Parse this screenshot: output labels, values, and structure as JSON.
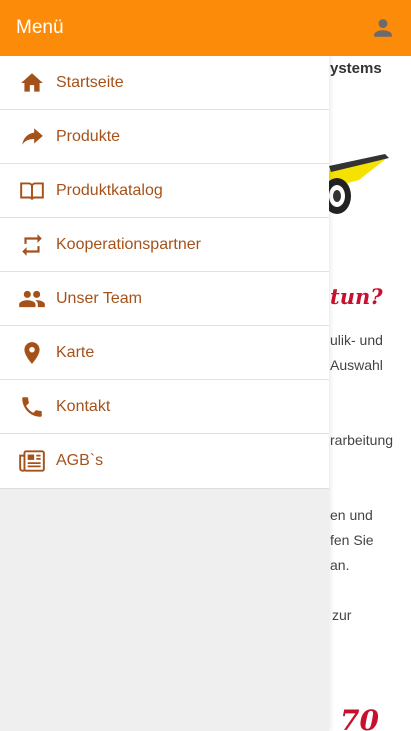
{
  "header": {
    "title": "Menü",
    "user_icon": "account-icon"
  },
  "menu": {
    "items": [
      {
        "label": "Startseite",
        "icon": "home-icon"
      },
      {
        "label": "Produkte",
        "icon": "share-arrow-icon"
      },
      {
        "label": "Produktkatalog",
        "icon": "book-icon"
      },
      {
        "label": "Kooperationspartner",
        "icon": "repeat-icon"
      },
      {
        "label": "Unser Team",
        "icon": "group-icon"
      },
      {
        "label": "Karte",
        "icon": "map-pin-icon"
      },
      {
        "label": "Kontakt",
        "icon": "phone-icon"
      },
      {
        "label": "AGB`s",
        "icon": "newspaper-icon"
      }
    ]
  },
  "background": {
    "brand_fragment": "ystems",
    "slogan_fragment": "tun?",
    "lines": [
      "ulik- und",
      "Auswahl",
      "rarbeitung",
      "en und",
      "fen Sie",
      "an.",
      "zur"
    ],
    "number_fragment": "70"
  },
  "colors": {
    "header_bg": "#fc8b09",
    "menu_text": "#a5521a",
    "slogan": "#c8102e"
  }
}
